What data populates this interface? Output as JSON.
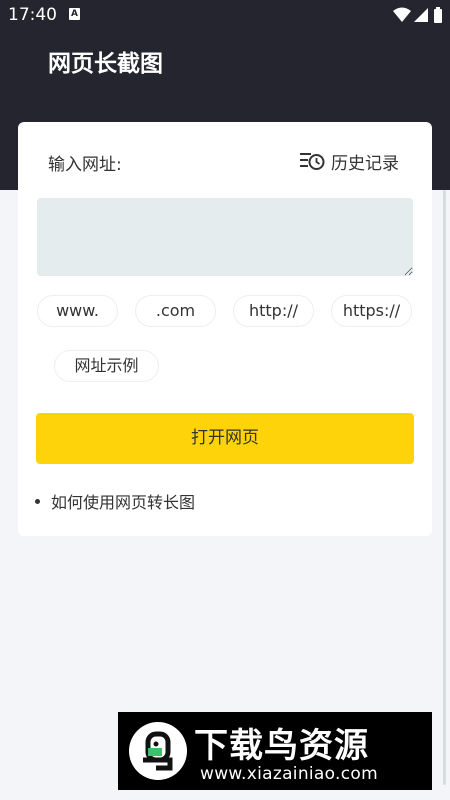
{
  "status_bar": {
    "time": "17:40",
    "notification_icon": "A",
    "icons": [
      "wifi-icon",
      "signal-icon",
      "battery-icon"
    ]
  },
  "header": {
    "title": "网页长截图"
  },
  "card": {
    "input_label": "输入网址:",
    "history_label": "历史记录",
    "url_input": {
      "value": "",
      "placeholder": ""
    },
    "chips": [
      "www.",
      ".com",
      "http://",
      "https://",
      "网址示例"
    ],
    "open_button_label": "打开网页",
    "howto_label": "如何使用网页转长图"
  },
  "watermark": {
    "title": "下载鸟资源",
    "url": "www.xiazainiao.com"
  },
  "colors": {
    "header_bg": "#25252f",
    "page_bg": "#f3f5f9",
    "accent": "#ffd30a",
    "input_bg": "#e4ecee"
  }
}
